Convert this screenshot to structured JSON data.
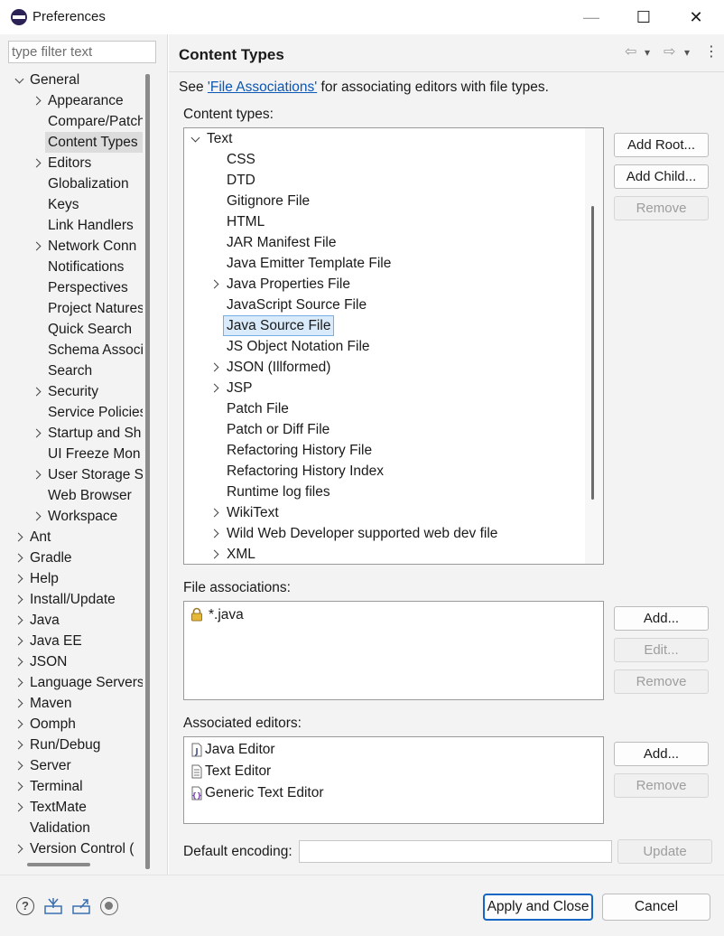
{
  "window": {
    "title": "Preferences",
    "minimize_glyph": "—",
    "maximize_glyph": "☐",
    "close_glyph": "✕"
  },
  "sidebar": {
    "filter_placeholder": "type filter text",
    "tree": [
      {
        "label": "General",
        "level": 0,
        "twisty": "open"
      },
      {
        "label": "Appearance",
        "level": 1,
        "twisty": "closed"
      },
      {
        "label": "Compare/Patch",
        "level": 1,
        "twisty": "none"
      },
      {
        "label": "Content Types",
        "level": 1,
        "twisty": "none",
        "selected": true
      },
      {
        "label": "Editors",
        "level": 1,
        "twisty": "closed"
      },
      {
        "label": "Globalization",
        "level": 1,
        "twisty": "none"
      },
      {
        "label": "Keys",
        "level": 1,
        "twisty": "none"
      },
      {
        "label": "Link Handlers",
        "level": 1,
        "twisty": "none"
      },
      {
        "label": "Network Conn",
        "level": 1,
        "twisty": "closed"
      },
      {
        "label": "Notifications",
        "level": 1,
        "twisty": "none"
      },
      {
        "label": "Perspectives",
        "level": 1,
        "twisty": "none"
      },
      {
        "label": "Project Natures",
        "level": 1,
        "twisty": "none"
      },
      {
        "label": "Quick Search",
        "level": 1,
        "twisty": "none"
      },
      {
        "label": "Schema Associ",
        "level": 1,
        "twisty": "none"
      },
      {
        "label": "Search",
        "level": 1,
        "twisty": "none"
      },
      {
        "label": "Security",
        "level": 1,
        "twisty": "closed"
      },
      {
        "label": "Service Policies",
        "level": 1,
        "twisty": "none"
      },
      {
        "label": "Startup and Sh",
        "level": 1,
        "twisty": "closed"
      },
      {
        "label": "UI Freeze Mon",
        "level": 1,
        "twisty": "none"
      },
      {
        "label": "User Storage S",
        "level": 1,
        "twisty": "closed"
      },
      {
        "label": "Web Browser",
        "level": 1,
        "twisty": "none"
      },
      {
        "label": "Workspace",
        "level": 1,
        "twisty": "closed"
      },
      {
        "label": "Ant",
        "level": 0,
        "twisty": "closed"
      },
      {
        "label": "Gradle",
        "level": 0,
        "twisty": "closed"
      },
      {
        "label": "Help",
        "level": 0,
        "twisty": "closed"
      },
      {
        "label": "Install/Update",
        "level": 0,
        "twisty": "closed"
      },
      {
        "label": "Java",
        "level": 0,
        "twisty": "closed"
      },
      {
        "label": "Java EE",
        "level": 0,
        "twisty": "closed"
      },
      {
        "label": "JSON",
        "level": 0,
        "twisty": "closed"
      },
      {
        "label": "Language Servers",
        "level": 0,
        "twisty": "closed"
      },
      {
        "label": "Maven",
        "level": 0,
        "twisty": "closed"
      },
      {
        "label": "Oomph",
        "level": 0,
        "twisty": "closed"
      },
      {
        "label": "Run/Debug",
        "level": 0,
        "twisty": "closed"
      },
      {
        "label": "Server",
        "level": 0,
        "twisty": "closed"
      },
      {
        "label": "Terminal",
        "level": 0,
        "twisty": "closed"
      },
      {
        "label": "TextMate",
        "level": 0,
        "twisty": "closed"
      },
      {
        "label": "Validation",
        "level": 0,
        "twisty": "none"
      },
      {
        "label": "Version Control (",
        "level": 0,
        "twisty": "closed"
      }
    ]
  },
  "main": {
    "title": "Content Types",
    "nav": {
      "back": "⇦",
      "back_menu": "▾",
      "forward": "⇨",
      "forward_menu": "▾",
      "more": "⋮"
    },
    "see_prefix": "See ",
    "see_link": "'File Associations'",
    "see_suffix": " for associating editors with file types.",
    "content_types_label": "Content types:",
    "content_types": [
      {
        "label": "Text",
        "level": 0,
        "twisty": "open"
      },
      {
        "label": "CSS",
        "level": 1,
        "twisty": "none"
      },
      {
        "label": "DTD",
        "level": 1,
        "twisty": "none"
      },
      {
        "label": "Gitignore File",
        "level": 1,
        "twisty": "none"
      },
      {
        "label": "HTML",
        "level": 1,
        "twisty": "none"
      },
      {
        "label": "JAR Manifest File",
        "level": 1,
        "twisty": "none"
      },
      {
        "label": "Java Emitter Template File",
        "level": 1,
        "twisty": "none"
      },
      {
        "label": "Java Properties File",
        "level": 1,
        "twisty": "closed"
      },
      {
        "label": "JavaScript Source File",
        "level": 1,
        "twisty": "none"
      },
      {
        "label": "Java Source File",
        "level": 1,
        "twisty": "none",
        "selected": true
      },
      {
        "label": "JS Object Notation File",
        "level": 1,
        "twisty": "none"
      },
      {
        "label": "JSON (Illformed)",
        "level": 1,
        "twisty": "closed"
      },
      {
        "label": "JSP",
        "level": 1,
        "twisty": "closed"
      },
      {
        "label": "Patch File",
        "level": 1,
        "twisty": "none"
      },
      {
        "label": "Patch or Diff File",
        "level": 1,
        "twisty": "none"
      },
      {
        "label": "Refactoring History File",
        "level": 1,
        "twisty": "none"
      },
      {
        "label": "Refactoring History Index",
        "level": 1,
        "twisty": "none"
      },
      {
        "label": "Runtime log files",
        "level": 1,
        "twisty": "none"
      },
      {
        "label": "WikiText",
        "level": 1,
        "twisty": "closed"
      },
      {
        "label": "Wild Web Developer supported web dev file",
        "level": 1,
        "twisty": "closed"
      },
      {
        "label": "XML",
        "level": 1,
        "twisty": "closed"
      }
    ],
    "content_buttons": {
      "add_root": "Add Root...",
      "add_child": "Add Child...",
      "remove": "Remove"
    },
    "file_assoc_label": "File associations:",
    "file_associations": [
      {
        "label": "*.java",
        "icon": "lock-icon"
      }
    ],
    "file_assoc_buttons": {
      "add": "Add...",
      "edit": "Edit...",
      "remove": "Remove"
    },
    "assoc_editors_label": "Associated editors:",
    "associated_editors": [
      {
        "label": "Java Editor",
        "icon": "java-file-icon"
      },
      {
        "label": "Text Editor",
        "icon": "text-file-icon"
      },
      {
        "label": "Generic Text Editor",
        "icon": "generic-editor-icon"
      }
    ],
    "editor_buttons": {
      "add": "Add...",
      "remove": "Remove"
    },
    "default_encoding_label": "Default encoding:",
    "default_encoding_value": "",
    "update_button": "Update"
  },
  "footer": {
    "help_glyph": "?",
    "apply_close": "Apply and Close",
    "cancel": "Cancel"
  },
  "colors": {
    "panel_bg": "#f3f3f3",
    "selection_bg": "#d9eafa",
    "selection_border": "#77aee3",
    "link": "#0b57b5",
    "default_button_border": "#1467c4"
  }
}
